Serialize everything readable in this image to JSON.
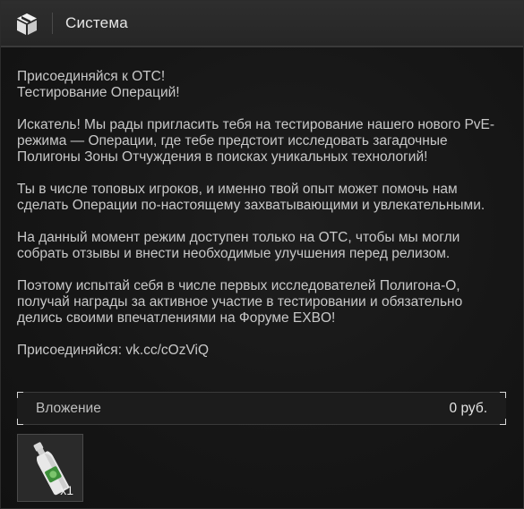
{
  "window": {
    "title": "Система",
    "icon": "package-icon"
  },
  "message": {
    "paragraphs": [
      "Присоединяйся к ОТС!\nТестирование Операций!",
      "Искатель! Мы рады пригласить тебя на тестирование нашего нового PvE-режима — Операции, где тебе предстоит исследовать загадочные Полигоны Зоны Отчуждения в поисках уникальных технологий!",
      "Ты в числе топовых игроков, и именно твой опыт может помочь нам сделать Операции по-настоящему захватывающими и увлекательными.",
      "На данный момент режим доступен только на ОТС, чтобы мы могли собрать отзывы и внести необходимые улучшения перед релизом.",
      "Поэтому испытай себя в числе первых исследователей Полигона-О, получай награды за активное участие в тестировании и обязательно делись своими впечатлениями на Форуме EXBO!",
      "Присоединяйся: vk.cc/cOzViQ"
    ]
  },
  "attachment": {
    "label": "Вложение",
    "price": "0 руб.",
    "item": {
      "icon": "bottle-icon",
      "quantity": "x1"
    }
  },
  "colors": {
    "background": "#161616",
    "titlebar": "#2a2a2a",
    "text": "#c8c8c8"
  }
}
